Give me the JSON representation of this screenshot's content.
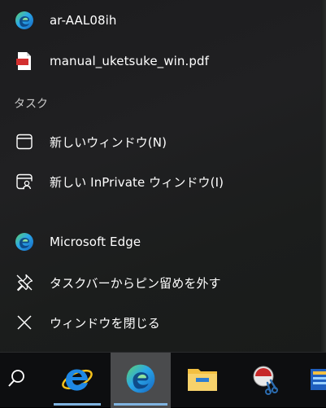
{
  "recent": [
    {
      "label": "ar-AAL08ih",
      "icon": "edge-icon"
    },
    {
      "label": "manual_uketsuke_win.pdf",
      "icon": "pdf-icon"
    }
  ],
  "tasks_header": "タスク",
  "tasks": [
    {
      "label": "新しいウィンドウ(N)",
      "icon": "window-icon"
    },
    {
      "label": "新しい InPrivate ウィンドウ(I)",
      "icon": "inprivate-window-icon"
    }
  ],
  "app_actions": [
    {
      "label": "Microsoft Edge",
      "icon": "edge-icon"
    },
    {
      "label": "タスクバーからピン留めを外す",
      "icon": "unpin-icon"
    },
    {
      "label": "ウィンドウを閉じる",
      "icon": "close-icon"
    }
  ],
  "pdf_badge": "PDF",
  "colors": {
    "accent": "#7fb3e0",
    "active_tile": "#4a4b4d",
    "pdf_red": "#d32f2f",
    "edge_blue": "#1e88e5",
    "edge_green": "#5fd26a",
    "folder_yellow": "#f3c041"
  }
}
